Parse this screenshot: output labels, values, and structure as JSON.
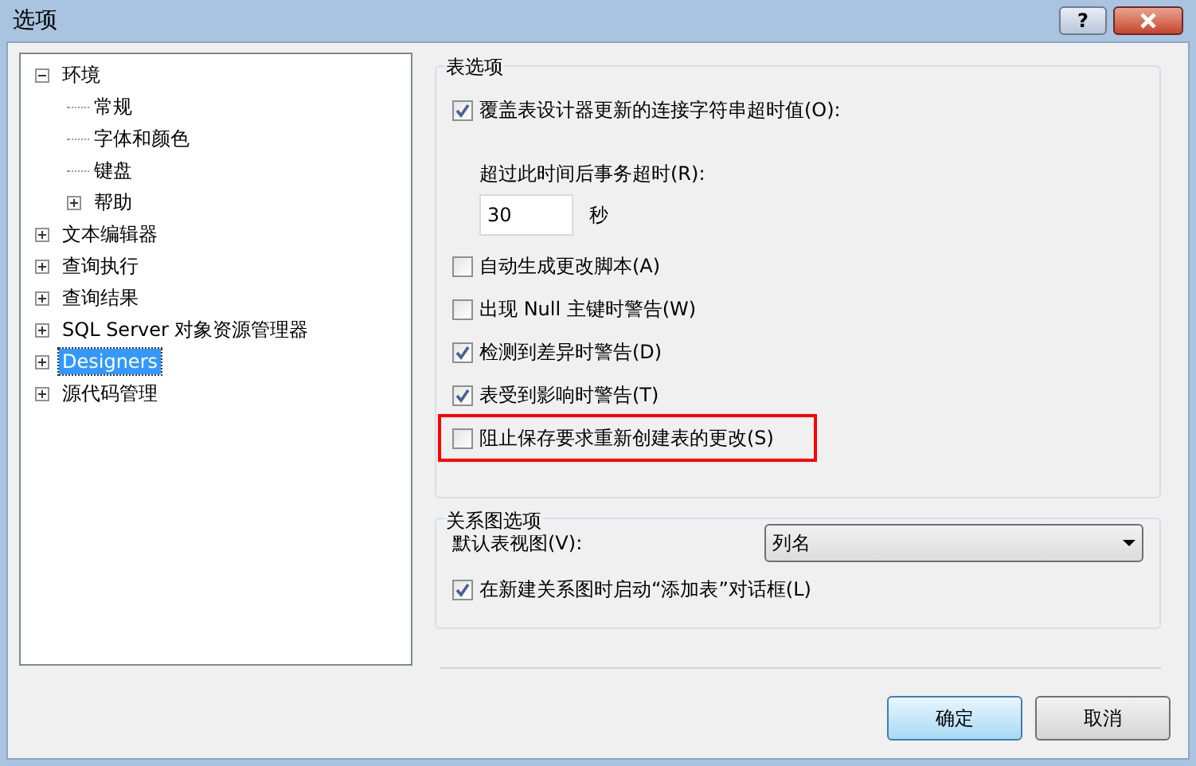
{
  "window": {
    "title": "选项",
    "help_label": "?"
  },
  "tree": [
    {
      "label": "环境",
      "expanded": true,
      "selected": false,
      "children": [
        {
          "label": "常规",
          "selected": false
        },
        {
          "label": "字体和颜色",
          "selected": false
        },
        {
          "label": "键盘",
          "selected": false
        },
        {
          "label": "帮助",
          "expanded": false,
          "selected": false
        }
      ]
    },
    {
      "label": "文本编辑器",
      "expanded": false,
      "selected": false
    },
    {
      "label": "查询执行",
      "expanded": false,
      "selected": false
    },
    {
      "label": "查询结果",
      "expanded": false,
      "selected": false
    },
    {
      "label": "SQL Server 对象资源管理器",
      "expanded": false,
      "selected": false
    },
    {
      "label": "Designers",
      "expanded": false,
      "selected": true
    },
    {
      "label": "源代码管理",
      "expanded": false,
      "selected": false
    }
  ],
  "table_options": {
    "title": "表选项",
    "items": [
      {
        "kind": "checkbox",
        "label": "覆盖表设计器更新的连接字符串超时值(O):",
        "checked": true,
        "highlighted": false
      },
      {
        "kind": "number",
        "label": "超过此时间后事务超时(R):",
        "value": "30",
        "unit": "秒"
      },
      {
        "kind": "checkbox",
        "label": "自动生成更改脚本(A)",
        "checked": false,
        "highlighted": false
      },
      {
        "kind": "checkbox",
        "label": "出现 Null 主键时警告(W)",
        "checked": false,
        "highlighted": false
      },
      {
        "kind": "checkbox",
        "label": "检测到差异时警告(D)",
        "checked": true,
        "highlighted": false
      },
      {
        "kind": "checkbox",
        "label": "表受到影响时警告(T)",
        "checked": true,
        "highlighted": false
      },
      {
        "kind": "checkbox",
        "label": "阻止保存要求重新创建表的更改(S)",
        "checked": false,
        "highlighted": true
      }
    ]
  },
  "diagram_options": {
    "title": "关系图选项",
    "default_view_label": "默认表视图(V):",
    "default_view_value": "列名",
    "items": [
      {
        "kind": "checkbox",
        "label": "在新建关系图时启动“添加表”对话框(L)",
        "checked": true,
        "highlighted": false
      }
    ]
  },
  "buttons": [
    {
      "label": "确定",
      "default": true
    },
    {
      "label": "取消",
      "default": false
    }
  ]
}
